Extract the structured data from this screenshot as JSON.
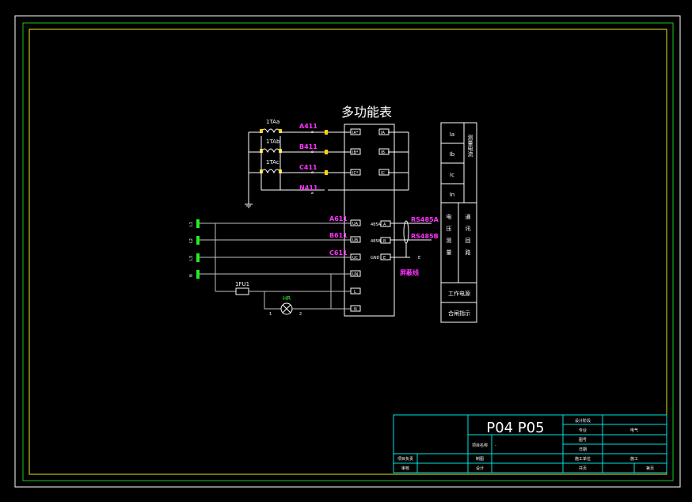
{
  "meter_title": "多功能表",
  "ct_labels": [
    "1TAa",
    "1TAb",
    "1TAc"
  ],
  "current_wires": [
    "A411",
    "B411",
    "C411",
    "N411"
  ],
  "current_terms_left": [
    "IA*",
    "IB*",
    "IC*"
  ],
  "current_terms_right": [
    "IA",
    "IB",
    "IC"
  ],
  "phase_labels": [
    "L1",
    "L2",
    "L3",
    "N"
  ],
  "voltage_wires": [
    "A611",
    "B611",
    "C611"
  ],
  "voltage_terms": [
    "UA",
    "UB",
    "UC",
    "UN"
  ],
  "power_terms": [
    "L",
    "N"
  ],
  "fuse_label": "1FU1",
  "lamp_label": "HR",
  "lamp_pins": [
    "1",
    "2"
  ],
  "comm_labels": [
    "RS485A",
    "RS485B"
  ],
  "comm_terms": [
    "A",
    "B",
    "E"
  ],
  "comm_pin_labels": [
    "485A",
    "485B",
    "GND"
  ],
  "shield_label": "屏蔽线",
  "e_label": "E",
  "legend": {
    "currents": [
      "Ia",
      "Ib",
      "Ic",
      "In"
    ],
    "current_group": "测量电流",
    "voltage_group": "电压测量",
    "comm_group": "通讯回路",
    "work_power": "工作电源",
    "close_indicator": "合闸指示"
  },
  "title_block": {
    "drawing_no": "P04 P05",
    "project_name_label": "项目名称",
    "project_name_value": "-",
    "project_leader": "项目负责",
    "review": "审核",
    "draw": "制图",
    "design": "设计",
    "design_unit": "设计阶段",
    "major_label": "专业",
    "major_value": "电气",
    "drawing_no_label": "图号",
    "date_label": "日期",
    "construction_label": "施工单位",
    "construction_value": "施工",
    "total_label": "共页",
    "page_label": "第页"
  },
  "colors": {
    "background": "#000000",
    "frame": "#ffffff",
    "border_green": "#19c819",
    "border_yellow": "#e6e619",
    "title_cyan": "#00e5e5",
    "wire_label": "#ff33ff",
    "terminal_yellow": "#ffd400",
    "phase_green": "#22ee22"
  }
}
